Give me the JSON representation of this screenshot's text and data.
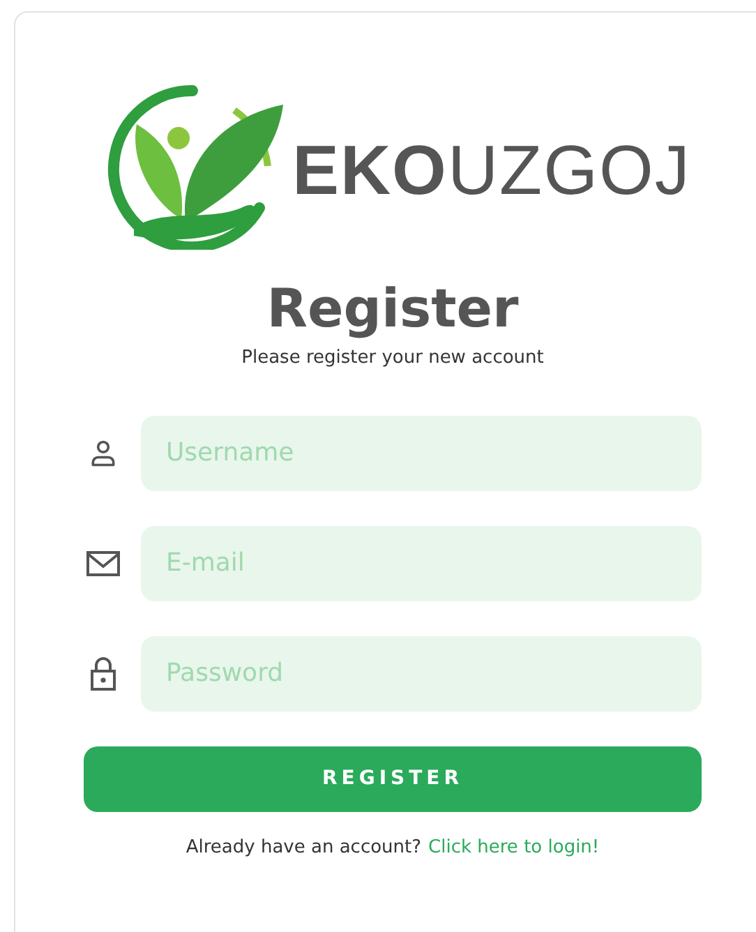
{
  "logo": {
    "wordmark": "**EKO**UZGOJ"
  },
  "title": "Register",
  "subtitle": "Please register your new account",
  "fields": [
    {
      "kind": "user",
      "placeholder": "Username"
    },
    {
      "kind": "mail",
      "placeholder": "E-mail"
    },
    {
      "kind": "lock",
      "placeholder": "Password"
    }
  ],
  "submit_button": "REGISTER",
  "footer": {
    "text": "Already have an account?",
    "link": "Click here to login!"
  }
}
